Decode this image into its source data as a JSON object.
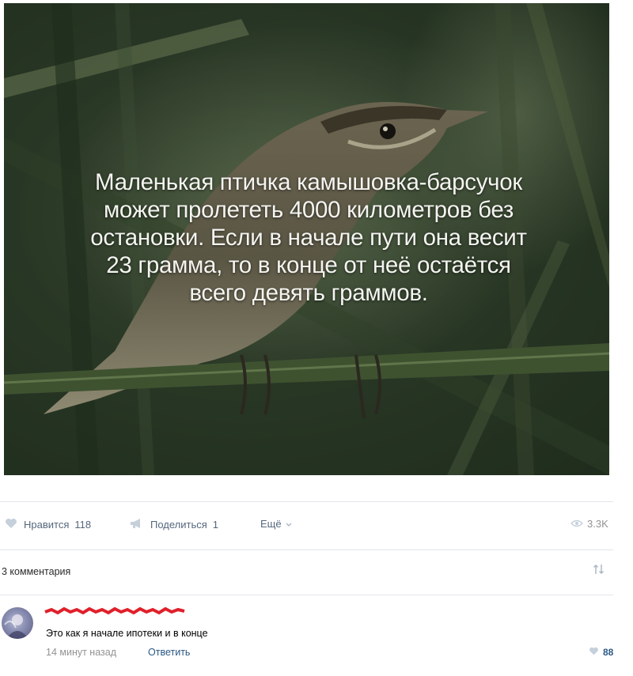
{
  "post": {
    "image_alt": "reed warbler on a reed stem",
    "caption_lines": [
      "Маленькая птичка камышовка-барсучок",
      "может пролететь 4000 километров без",
      "остановки. Если в начале пути она весит",
      "23 грамма, то в конце от неё остаётся",
      "всего девять граммов."
    ]
  },
  "actions": {
    "like_label": "Нравится",
    "like_count": "118",
    "share_label": "Поделиться",
    "share_count": "1",
    "more_label": "Ещё",
    "views": "3.3K"
  },
  "comments": {
    "header": "3 комментария",
    "items": [
      {
        "text": "Это как я начале ипотеки и в конце",
        "time": "14 минут назад",
        "reply_label": "Ответить",
        "likes": "88"
      }
    ]
  },
  "colors": {
    "link": "#2a5885",
    "muted": "#939393",
    "icon": "#aab4c0",
    "redaction": "#e0202a"
  },
  "icons": {
    "like": "heart-icon",
    "share": "megaphone-icon",
    "more": "chevron-down-icon",
    "views": "eye-icon",
    "sort": "sort-arrows-icon"
  }
}
